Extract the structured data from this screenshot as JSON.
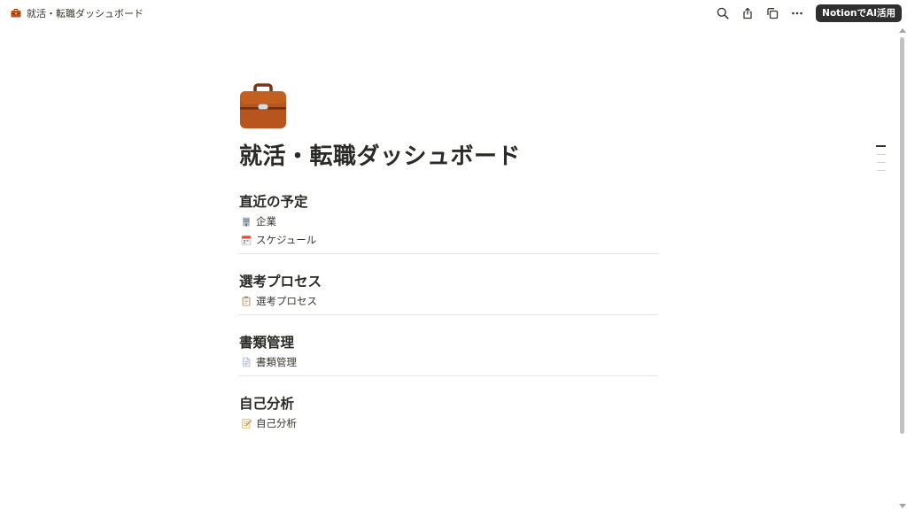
{
  "topbar": {
    "breadcrumb_title": "就活・転職ダッシュボード",
    "breadcrumb_icon": "briefcase-icon",
    "actions": {
      "search_icon": "search-icon",
      "share_icon": "share-icon",
      "duplicate_icon": "duplicate-icon",
      "more_icon": "more-icon",
      "ai_button_label": "NotionでAI活用"
    }
  },
  "page": {
    "icon": "briefcase-icon",
    "title": "就活・転職ダッシュボード",
    "sections": [
      {
        "heading": "直近の予定",
        "links": [
          {
            "label": "企業",
            "icon": "office-building-icon"
          },
          {
            "label": "スケジュール",
            "icon": "calendar-icon"
          }
        ]
      },
      {
        "heading": "選考プロセス",
        "links": [
          {
            "label": "選考プロセス",
            "icon": "clipboard-icon"
          }
        ]
      },
      {
        "heading": "書類管理",
        "links": [
          {
            "label": "書類管理",
            "icon": "document-icon"
          }
        ]
      },
      {
        "heading": "自己分析",
        "links": [
          {
            "label": "自己分析",
            "icon": "memo-icon"
          }
        ]
      }
    ]
  },
  "colors": {
    "briefcase_body": "#b8541e",
    "briefcase_handle": "#7a3612",
    "ai_button_bg": "#2f2f2f",
    "text": "#37352f",
    "divider": "#e6e5e2"
  }
}
